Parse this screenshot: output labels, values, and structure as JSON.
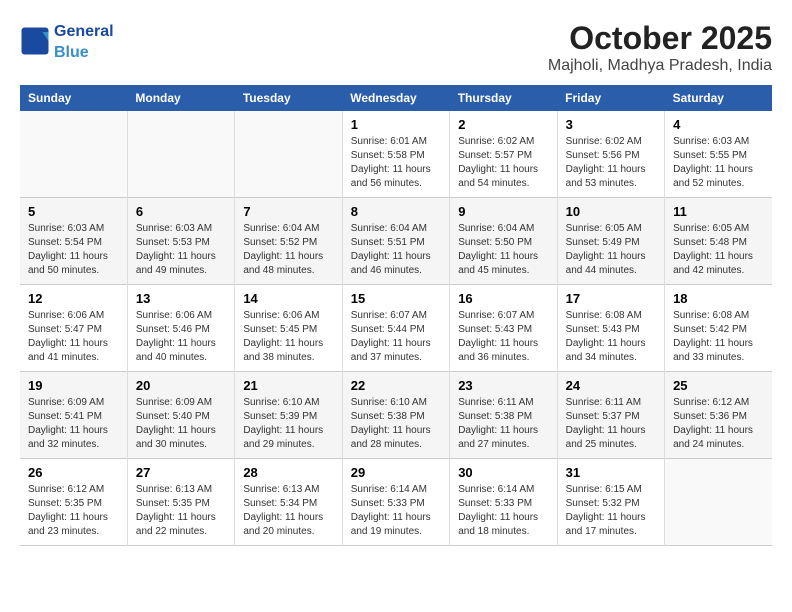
{
  "header": {
    "logo_general": "General",
    "logo_blue": "Blue",
    "month": "October 2025",
    "location": "Majholi, Madhya Pradesh, India"
  },
  "weekdays": [
    "Sunday",
    "Monday",
    "Tuesday",
    "Wednesday",
    "Thursday",
    "Friday",
    "Saturday"
  ],
  "weeks": [
    [
      {
        "day": "",
        "sunrise": "",
        "sunset": "",
        "daylight": ""
      },
      {
        "day": "",
        "sunrise": "",
        "sunset": "",
        "daylight": ""
      },
      {
        "day": "",
        "sunrise": "",
        "sunset": "",
        "daylight": ""
      },
      {
        "day": "1",
        "sunrise": "Sunrise: 6:01 AM",
        "sunset": "Sunset: 5:58 PM",
        "daylight": "Daylight: 11 hours and 56 minutes."
      },
      {
        "day": "2",
        "sunrise": "Sunrise: 6:02 AM",
        "sunset": "Sunset: 5:57 PM",
        "daylight": "Daylight: 11 hours and 54 minutes."
      },
      {
        "day": "3",
        "sunrise": "Sunrise: 6:02 AM",
        "sunset": "Sunset: 5:56 PM",
        "daylight": "Daylight: 11 hours and 53 minutes."
      },
      {
        "day": "4",
        "sunrise": "Sunrise: 6:03 AM",
        "sunset": "Sunset: 5:55 PM",
        "daylight": "Daylight: 11 hours and 52 minutes."
      }
    ],
    [
      {
        "day": "5",
        "sunrise": "Sunrise: 6:03 AM",
        "sunset": "Sunset: 5:54 PM",
        "daylight": "Daylight: 11 hours and 50 minutes."
      },
      {
        "day": "6",
        "sunrise": "Sunrise: 6:03 AM",
        "sunset": "Sunset: 5:53 PM",
        "daylight": "Daylight: 11 hours and 49 minutes."
      },
      {
        "day": "7",
        "sunrise": "Sunrise: 6:04 AM",
        "sunset": "Sunset: 5:52 PM",
        "daylight": "Daylight: 11 hours and 48 minutes."
      },
      {
        "day": "8",
        "sunrise": "Sunrise: 6:04 AM",
        "sunset": "Sunset: 5:51 PM",
        "daylight": "Daylight: 11 hours and 46 minutes."
      },
      {
        "day": "9",
        "sunrise": "Sunrise: 6:04 AM",
        "sunset": "Sunset: 5:50 PM",
        "daylight": "Daylight: 11 hours and 45 minutes."
      },
      {
        "day": "10",
        "sunrise": "Sunrise: 6:05 AM",
        "sunset": "Sunset: 5:49 PM",
        "daylight": "Daylight: 11 hours and 44 minutes."
      },
      {
        "day": "11",
        "sunrise": "Sunrise: 6:05 AM",
        "sunset": "Sunset: 5:48 PM",
        "daylight": "Daylight: 11 hours and 42 minutes."
      }
    ],
    [
      {
        "day": "12",
        "sunrise": "Sunrise: 6:06 AM",
        "sunset": "Sunset: 5:47 PM",
        "daylight": "Daylight: 11 hours and 41 minutes."
      },
      {
        "day": "13",
        "sunrise": "Sunrise: 6:06 AM",
        "sunset": "Sunset: 5:46 PM",
        "daylight": "Daylight: 11 hours and 40 minutes."
      },
      {
        "day": "14",
        "sunrise": "Sunrise: 6:06 AM",
        "sunset": "Sunset: 5:45 PM",
        "daylight": "Daylight: 11 hours and 38 minutes."
      },
      {
        "day": "15",
        "sunrise": "Sunrise: 6:07 AM",
        "sunset": "Sunset: 5:44 PM",
        "daylight": "Daylight: 11 hours and 37 minutes."
      },
      {
        "day": "16",
        "sunrise": "Sunrise: 6:07 AM",
        "sunset": "Sunset: 5:43 PM",
        "daylight": "Daylight: 11 hours and 36 minutes."
      },
      {
        "day": "17",
        "sunrise": "Sunrise: 6:08 AM",
        "sunset": "Sunset: 5:43 PM",
        "daylight": "Daylight: 11 hours and 34 minutes."
      },
      {
        "day": "18",
        "sunrise": "Sunrise: 6:08 AM",
        "sunset": "Sunset: 5:42 PM",
        "daylight": "Daylight: 11 hours and 33 minutes."
      }
    ],
    [
      {
        "day": "19",
        "sunrise": "Sunrise: 6:09 AM",
        "sunset": "Sunset: 5:41 PM",
        "daylight": "Daylight: 11 hours and 32 minutes."
      },
      {
        "day": "20",
        "sunrise": "Sunrise: 6:09 AM",
        "sunset": "Sunset: 5:40 PM",
        "daylight": "Daylight: 11 hours and 30 minutes."
      },
      {
        "day": "21",
        "sunrise": "Sunrise: 6:10 AM",
        "sunset": "Sunset: 5:39 PM",
        "daylight": "Daylight: 11 hours and 29 minutes."
      },
      {
        "day": "22",
        "sunrise": "Sunrise: 6:10 AM",
        "sunset": "Sunset: 5:38 PM",
        "daylight": "Daylight: 11 hours and 28 minutes."
      },
      {
        "day": "23",
        "sunrise": "Sunrise: 6:11 AM",
        "sunset": "Sunset: 5:38 PM",
        "daylight": "Daylight: 11 hours and 27 minutes."
      },
      {
        "day": "24",
        "sunrise": "Sunrise: 6:11 AM",
        "sunset": "Sunset: 5:37 PM",
        "daylight": "Daylight: 11 hours and 25 minutes."
      },
      {
        "day": "25",
        "sunrise": "Sunrise: 6:12 AM",
        "sunset": "Sunset: 5:36 PM",
        "daylight": "Daylight: 11 hours and 24 minutes."
      }
    ],
    [
      {
        "day": "26",
        "sunrise": "Sunrise: 6:12 AM",
        "sunset": "Sunset: 5:35 PM",
        "daylight": "Daylight: 11 hours and 23 minutes."
      },
      {
        "day": "27",
        "sunrise": "Sunrise: 6:13 AM",
        "sunset": "Sunset: 5:35 PM",
        "daylight": "Daylight: 11 hours and 22 minutes."
      },
      {
        "day": "28",
        "sunrise": "Sunrise: 6:13 AM",
        "sunset": "Sunset: 5:34 PM",
        "daylight": "Daylight: 11 hours and 20 minutes."
      },
      {
        "day": "29",
        "sunrise": "Sunrise: 6:14 AM",
        "sunset": "Sunset: 5:33 PM",
        "daylight": "Daylight: 11 hours and 19 minutes."
      },
      {
        "day": "30",
        "sunrise": "Sunrise: 6:14 AM",
        "sunset": "Sunset: 5:33 PM",
        "daylight": "Daylight: 11 hours and 18 minutes."
      },
      {
        "day": "31",
        "sunrise": "Sunrise: 6:15 AM",
        "sunset": "Sunset: 5:32 PM",
        "daylight": "Daylight: 11 hours and 17 minutes."
      },
      {
        "day": "",
        "sunrise": "",
        "sunset": "",
        "daylight": ""
      }
    ]
  ]
}
